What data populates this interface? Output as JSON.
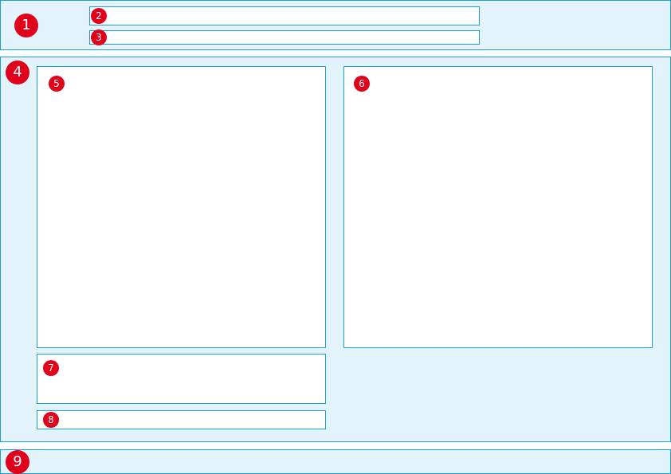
{
  "markers": {
    "header": "1",
    "title_bar": "2",
    "subtitle_bar": "3",
    "content_area": "4",
    "left_panel": "5",
    "right_panel": "6",
    "caption_box": "7",
    "caption_bar": "8",
    "footer": "9"
  },
  "colors": {
    "region_fill": "#e3f3fc",
    "region_border": "#1aa0d4",
    "panel_fill": "#ffffff",
    "marker_fill": "#e0001b",
    "marker_text": "#ffffff"
  }
}
